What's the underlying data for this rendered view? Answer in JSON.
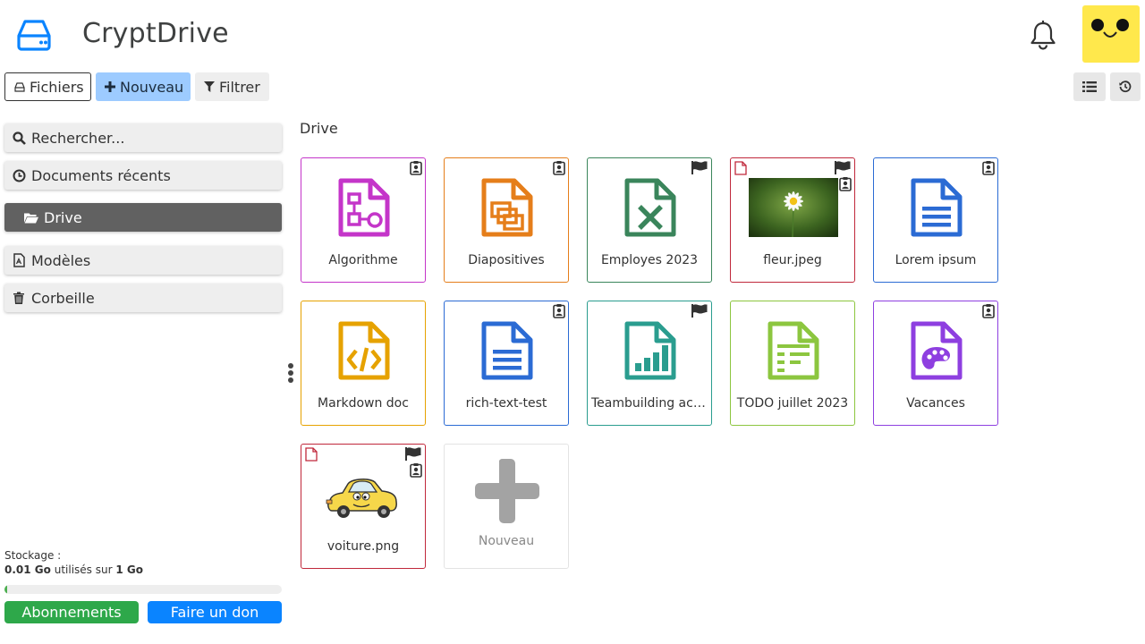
{
  "app": {
    "title": "CryptDrive"
  },
  "toolbar": {
    "files_label": "Fichiers",
    "new_label": "Nouveau",
    "filter_label": "Filtrer"
  },
  "sidebar": {
    "items": [
      {
        "label": "Rechercher..."
      },
      {
        "label": "Documents récents"
      },
      {
        "label": "Drive"
      },
      {
        "label": "Modèles"
      },
      {
        "label": "Corbeille"
      }
    ]
  },
  "storage": {
    "label": "Stockage :",
    "used": "0.01 Go",
    "middle": "utilisés sur",
    "total": "1 Go",
    "used_fraction": 0.01
  },
  "buttons": {
    "subscriptions": "Abonnements",
    "donate": "Faire un don"
  },
  "breadcrumb": "Drive",
  "files": [
    {
      "name": "Algorithme",
      "type": "diagram",
      "color": "#c435c9",
      "badges": [
        "owner"
      ]
    },
    {
      "name": "Diapositives",
      "type": "slides",
      "color": "#e57e1a",
      "badges": [
        "owner"
      ]
    },
    {
      "name": "Employes 2023",
      "type": "sheet",
      "color": "#3a855b",
      "badges": [
        "flag"
      ]
    },
    {
      "name": "fleur.jpeg",
      "type": "image-flower",
      "color": "#c0283b",
      "badges": [
        "flag",
        "owner"
      ]
    },
    {
      "name": "Lorem ipsum",
      "type": "doc",
      "color": "#2b6bd4",
      "badges": [
        "owner"
      ]
    },
    {
      "name": "Markdown doc",
      "type": "code",
      "color": "#e6a200",
      "badges": []
    },
    {
      "name": "rich-text-test",
      "type": "doc",
      "color": "#2b6bd4",
      "badges": [
        "owner"
      ]
    },
    {
      "name": "Teambuilding activities",
      "type": "chart",
      "color": "#2a9d8f",
      "badges": [
        "flag"
      ]
    },
    {
      "name": "TODO juillet 2023",
      "type": "kanban",
      "color": "#8cc63f",
      "badges": []
    },
    {
      "name": "Vacances",
      "type": "whiteboard",
      "color": "#8e3fe0",
      "badges": [
        "owner"
      ]
    },
    {
      "name": "voiture.png",
      "type": "image-car",
      "color": "#c0283b",
      "badges": [
        "flag",
        "owner"
      ]
    }
  ],
  "new_tile_label": "Nouveau"
}
